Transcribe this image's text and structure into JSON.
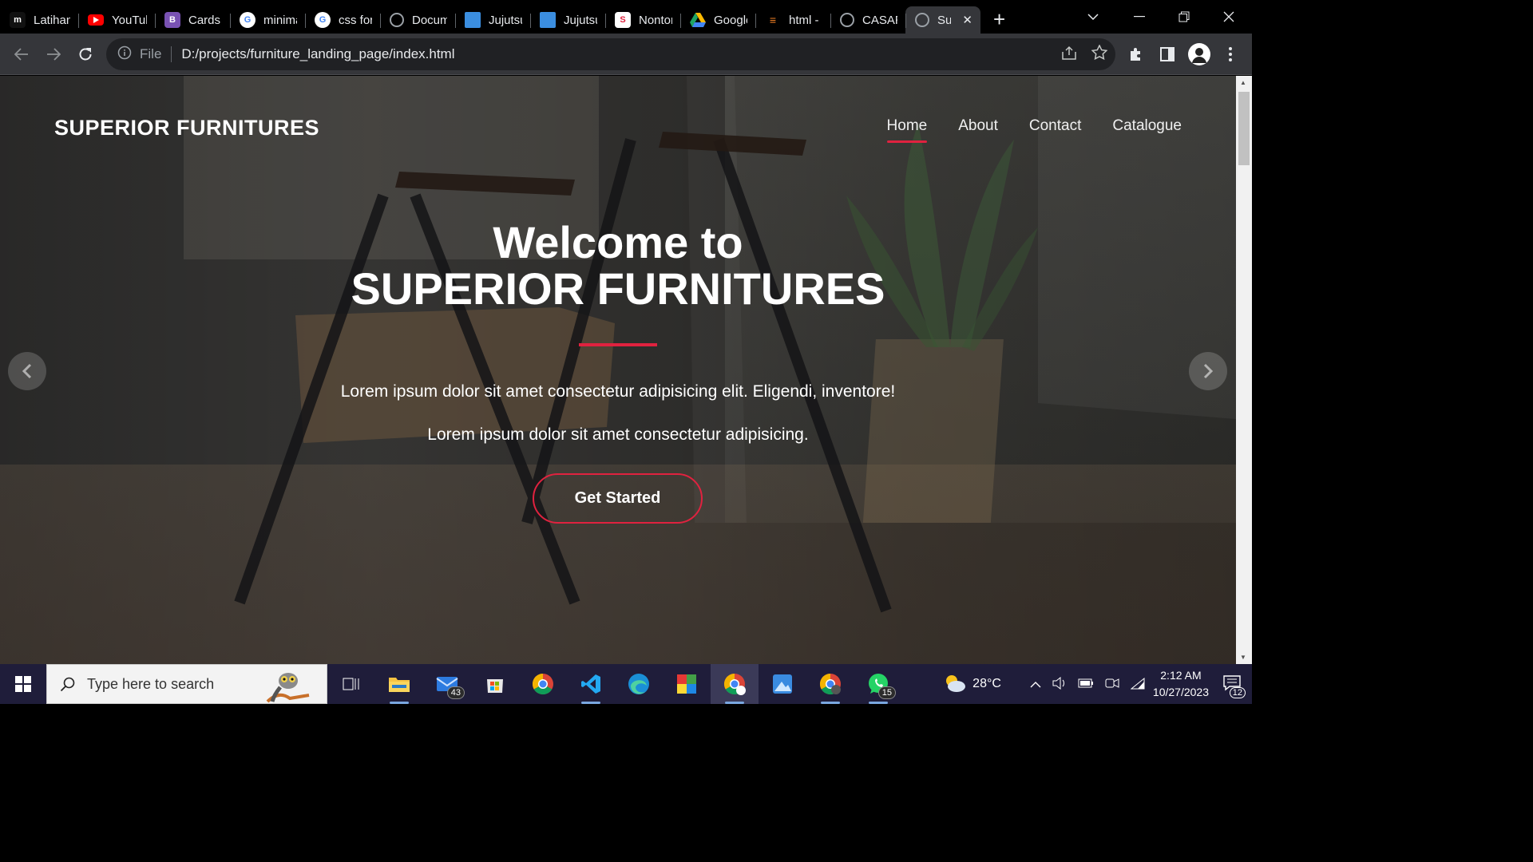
{
  "browser": {
    "tabs": [
      {
        "label": "Latihan",
        "icon": "m-logo-icon",
        "color": "#111111"
      },
      {
        "label": "YouTube",
        "icon": "youtube-icon",
        "color": "#ff0000"
      },
      {
        "label": "Cards -",
        "icon": "bootstrap-icon",
        "color": "#7952b3"
      },
      {
        "label": "minima",
        "icon": "google-icon",
        "color": "#ffffff"
      },
      {
        "label": "css for",
        "icon": "google-icon",
        "color": "#ffffff"
      },
      {
        "label": "Docum",
        "icon": "globe-icon",
        "color": "#9aa0a6"
      },
      {
        "label": "Jujutsu",
        "icon": "book-icon",
        "color": "#3b8ee0"
      },
      {
        "label": "Jujutsu",
        "icon": "book-icon",
        "color": "#3b8ee0"
      },
      {
        "label": "Nonton",
        "icon": "s-logo-icon",
        "color": "#e0223f"
      },
      {
        "label": "Google",
        "icon": "drive-icon",
        "color": "#1fa463"
      },
      {
        "label": "html -",
        "icon": "stackoverflow-icon",
        "color": "#f48024"
      },
      {
        "label": "CASAR",
        "icon": "globe-icon",
        "color": "#9aa0a6"
      },
      {
        "label": "Su",
        "icon": "globe-icon",
        "color": "#9aa0a6",
        "active": true
      }
    ],
    "address": {
      "scheme": "File",
      "url": "D:/projects/furniture_landing_page/index.html"
    }
  },
  "page": {
    "brand": "SUPERIOR FURNITURES",
    "nav": [
      {
        "label": "Home",
        "active": true
      },
      {
        "label": "About"
      },
      {
        "label": "Contact"
      },
      {
        "label": "Catalogue"
      }
    ],
    "hero": {
      "title_line1": "Welcome to",
      "title_line2": "SUPERIOR FURNITURES",
      "text1": "Lorem ipsum dolor sit amet consectetur adipisicing elit. Eligendi, inventore!",
      "text2": "Lorem ipsum dolor sit amet consectetur adipisicing.",
      "cta": "Get Started"
    },
    "accent_color": "#e0223f"
  },
  "taskbar": {
    "search_placeholder": "Type here to search",
    "mail_badge": "43",
    "whatsapp_badge": "15",
    "weather": "28°C",
    "time": "2:12 AM",
    "date": "10/27/2023",
    "notification_count": "12"
  }
}
